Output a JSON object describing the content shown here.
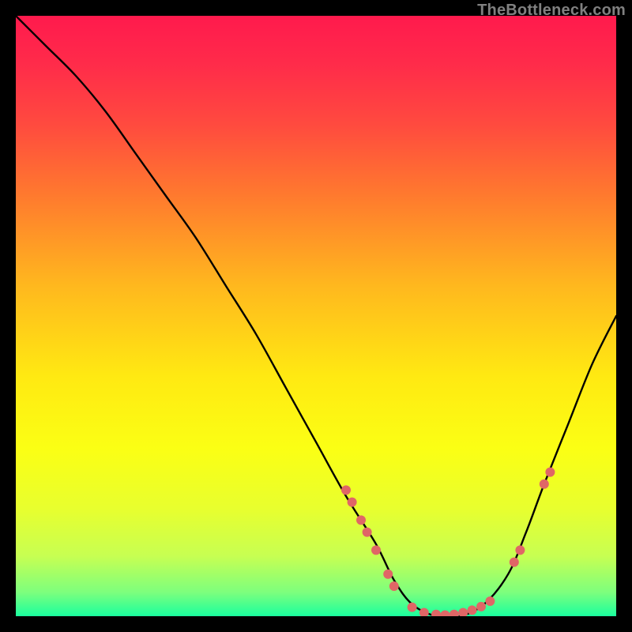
{
  "watermark": "TheBottleneck.com",
  "chart_data": {
    "type": "line",
    "title": "",
    "xlabel": "",
    "ylabel": "",
    "xlim": [
      0,
      100
    ],
    "ylim": [
      0,
      100
    ],
    "gradient_stops": [
      {
        "offset": 0.0,
        "color": "#ff1a4d"
      },
      {
        "offset": 0.08,
        "color": "#ff2b4a"
      },
      {
        "offset": 0.18,
        "color": "#ff4a3f"
      },
      {
        "offset": 0.3,
        "color": "#ff7a2e"
      },
      {
        "offset": 0.45,
        "color": "#ffb81e"
      },
      {
        "offset": 0.6,
        "color": "#ffe912"
      },
      {
        "offset": 0.72,
        "color": "#fbff14"
      },
      {
        "offset": 0.82,
        "color": "#e8ff2e"
      },
      {
        "offset": 0.9,
        "color": "#c7ff52"
      },
      {
        "offset": 0.96,
        "color": "#7dff7d"
      },
      {
        "offset": 1.0,
        "color": "#1aff9e"
      }
    ],
    "series": [
      {
        "name": "bottleneck-curve",
        "x": [
          0,
          5,
          10,
          15,
          20,
          25,
          30,
          35,
          40,
          45,
          50,
          55,
          60,
          63,
          66,
          70,
          74,
          78,
          82,
          85,
          88,
          92,
          96,
          100
        ],
        "y": [
          100,
          95,
          90,
          84,
          77,
          70,
          63,
          55,
          47,
          38,
          29,
          20,
          12,
          6,
          2,
          0,
          0,
          2,
          7,
          14,
          22,
          32,
          42,
          50
        ]
      }
    ],
    "markers": {
      "name": "highlight-dots",
      "color": "#e06666",
      "radius": 6,
      "points": [
        {
          "x": 55,
          "y": 21
        },
        {
          "x": 56,
          "y": 19
        },
        {
          "x": 57.5,
          "y": 16
        },
        {
          "x": 58.5,
          "y": 14
        },
        {
          "x": 60,
          "y": 11
        },
        {
          "x": 62,
          "y": 7
        },
        {
          "x": 63,
          "y": 5
        },
        {
          "x": 66,
          "y": 1.5
        },
        {
          "x": 68,
          "y": 0.6
        },
        {
          "x": 70,
          "y": 0.3
        },
        {
          "x": 71.5,
          "y": 0.2
        },
        {
          "x": 73,
          "y": 0.3
        },
        {
          "x": 74.5,
          "y": 0.6
        },
        {
          "x": 76,
          "y": 1.0
        },
        {
          "x": 77.5,
          "y": 1.6
        },
        {
          "x": 79,
          "y": 2.5
        },
        {
          "x": 83,
          "y": 9
        },
        {
          "x": 84,
          "y": 11
        },
        {
          "x": 88,
          "y": 22
        },
        {
          "x": 89,
          "y": 24
        }
      ]
    }
  }
}
